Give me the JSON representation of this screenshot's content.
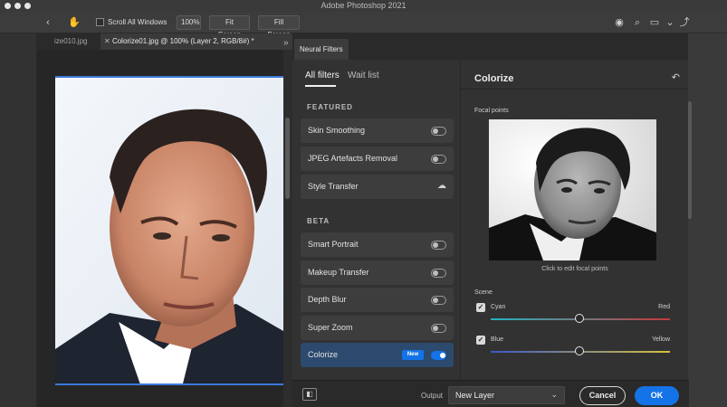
{
  "window": {
    "title": "Adobe Photoshop 2021"
  },
  "options_bar": {
    "scroll_all_windows": "Scroll All Windows",
    "zoom_100": "100%",
    "fit_screen": "Fit Screen",
    "fill_screen": "Fill Screen"
  },
  "documents": {
    "inactive_tab": "ize010.jpg",
    "active_tab": "Colorize01.jpg @ 100% (Layer 2, RGB/8#) *"
  },
  "neural_filters": {
    "panel_title": "Neural Filters",
    "tabs": {
      "all": "All filters",
      "wait": "Wait list"
    },
    "featured_heading": "FEATURED",
    "beta_heading": "BETA",
    "featured": [
      {
        "label": "Skin Smoothing",
        "state": "off"
      },
      {
        "label": "JPEG Artefacts Removal",
        "state": "off"
      },
      {
        "label": "Style Transfer",
        "state": "cloud"
      }
    ],
    "beta": [
      {
        "label": "Smart Portrait",
        "state": "off"
      },
      {
        "label": "Makeup Transfer",
        "state": "off"
      },
      {
        "label": "Depth Blur",
        "state": "off"
      },
      {
        "label": "Super Zoom",
        "state": "off"
      },
      {
        "label": "Colorize",
        "state": "on",
        "badge": "New"
      }
    ],
    "settings": {
      "title": "Colorize",
      "focal_points": "Focal points",
      "preview_caption": "Click to edit focal points",
      "scene": "Scene",
      "sliders": [
        {
          "left": "Cyan",
          "right": "Red",
          "value": 0.5,
          "checked": true
        },
        {
          "left": "Blue",
          "right": "Yellow",
          "value": 0.5,
          "checked": true
        }
      ]
    },
    "footer": {
      "output_label": "Output",
      "output_value": "New Layer",
      "cancel": "Cancel",
      "ok": "OK"
    }
  },
  "colors": {
    "accent": "#1473e6",
    "panel_bg": "#323232",
    "selection": "#2c4a6e"
  }
}
